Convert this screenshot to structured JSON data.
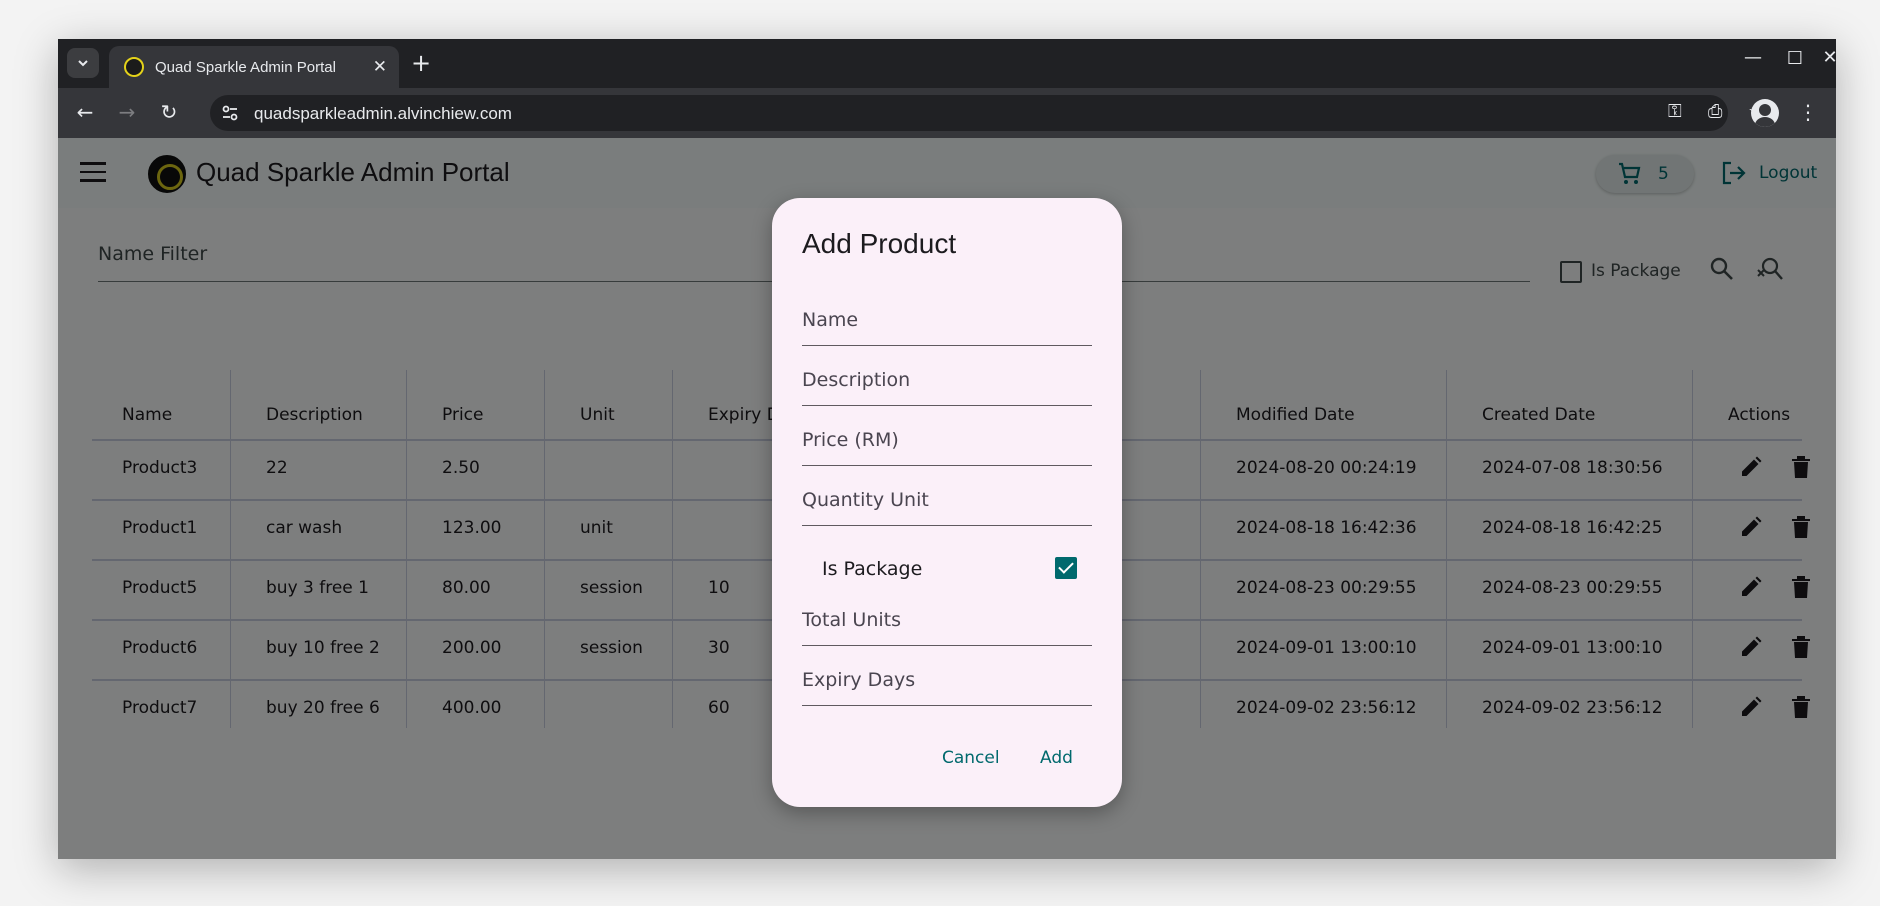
{
  "browser": {
    "tab_title": "Quad Sparkle Admin Portal",
    "url": "quadsparkleadmin.alvinchiew.com"
  },
  "app": {
    "title": "Quad Sparkle Admin Portal",
    "cart_count": "5",
    "logout_label": "Logout"
  },
  "filter": {
    "name_placeholder": "Name Filter",
    "is_package_label": "Is Package"
  },
  "table": {
    "columns": [
      "Name",
      "Description",
      "Price",
      "Unit",
      "Expiry D",
      "Modified Date",
      "Created Date",
      "Actions"
    ],
    "rows": [
      {
        "name": "Product3",
        "description": "22",
        "price": "2.50",
        "unit": "",
        "expiry": "",
        "modified": "2024-08-20 00:24:19",
        "created": "2024-07-08 18:30:56"
      },
      {
        "name": "Product1",
        "description": "car wash",
        "price": "123.00",
        "unit": "unit",
        "expiry": "",
        "modified": "2024-08-18 16:42:36",
        "created": "2024-08-18 16:42:25"
      },
      {
        "name": "Product5",
        "description": "buy 3 free 1",
        "price": "80.00",
        "unit": "session",
        "expiry": "10",
        "modified": "2024-08-23 00:29:55",
        "created": "2024-08-23 00:29:55"
      },
      {
        "name": "Product6",
        "description": "buy 10 free 2",
        "price": "200.00",
        "unit": "session",
        "expiry": "30",
        "modified": "2024-09-01 13:00:10",
        "created": "2024-09-01 13:00:10"
      },
      {
        "name": "Product7",
        "description": "buy 20 free 6",
        "price": "400.00",
        "unit": "",
        "expiry": "60",
        "modified": "2024-09-02 23:56:12",
        "created": "2024-09-02 23:56:12"
      }
    ]
  },
  "dialog": {
    "title": "Add Product",
    "name_placeholder": "Name",
    "description_placeholder": "Description",
    "price_placeholder": "Price (RM)",
    "quantity_unit_placeholder": "Quantity Unit",
    "is_package_label": "Is Package",
    "is_package_checked": true,
    "total_units_placeholder": "Total Units",
    "expiry_days_placeholder": "Expiry Days",
    "cancel_label": "Cancel",
    "add_label": "Add"
  },
  "colors": {
    "accent": "#00696d",
    "dialog_bg": "#fbf0f9"
  }
}
